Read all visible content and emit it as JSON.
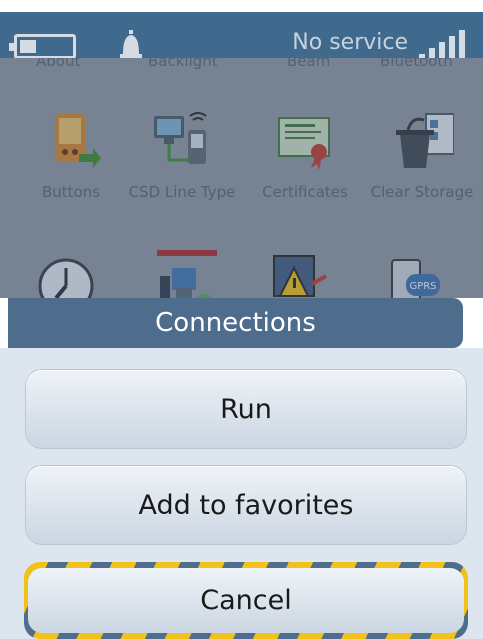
{
  "status_bar": {
    "network_text": "No service",
    "battery_icon": "battery-icon",
    "bell_icon": "bell-icon",
    "signal_icon": "signal-icon"
  },
  "launcher": {
    "partial_row": [
      "About",
      "Backlight",
      "Beam",
      "Bluetooth"
    ],
    "tiles": [
      {
        "label": "Buttons",
        "icon": "buttons-icon"
      },
      {
        "label": "CSD Line Type",
        "icon": "csd-line-type-icon"
      },
      {
        "label": "Certificates",
        "icon": "certificates-icon"
      },
      {
        "label": "Clear Storage",
        "icon": "clear-storage-icon"
      }
    ],
    "bottom_icons": [
      "clock-icon",
      "connections-icon",
      "error-reporting-icon",
      "gprs-icon"
    ]
  },
  "menu": {
    "title": "Connections",
    "run": "Run",
    "add_favorites": "Add to favorites",
    "cancel": "Cancel"
  },
  "colors": {
    "status_bar": "#3f6a8e",
    "menu_header": "#4e6c8c",
    "accent_stripe": "#f2c21a"
  }
}
